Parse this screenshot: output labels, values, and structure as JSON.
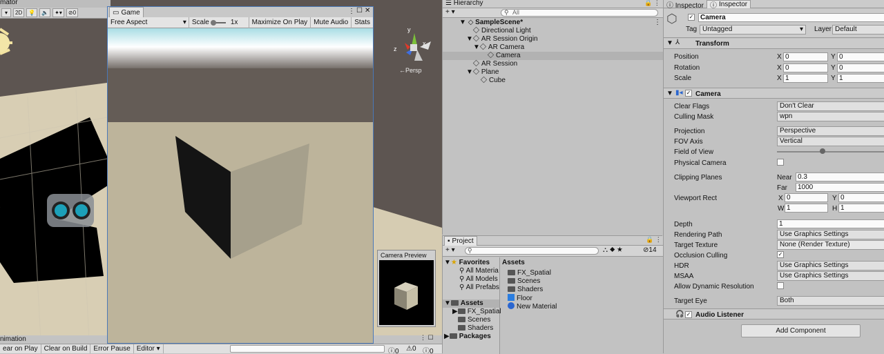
{
  "scene": {
    "title_fragment": "mator",
    "toolbar": {
      "mode_2d": "2D",
      "hidden_count": "0"
    },
    "persp_label": "←Persp",
    "gizmo": {
      "y": "y",
      "x": "x",
      "z": "z"
    }
  },
  "game": {
    "tab_label": "Game",
    "aspect": "Free Aspect",
    "scale_label": "Scale",
    "scale_value": "1x",
    "maximize": "Maximize On Play",
    "mute": "Mute Audio",
    "stats": "Stats"
  },
  "camera_preview": {
    "title": "Camera Preview"
  },
  "console": {
    "tab_label": "nimation",
    "clear_on_play": "ear on Play",
    "clear_on_build": "Clear on Build",
    "error_pause": "Error Pause",
    "editor": "Editor",
    "counts": [
      "0",
      "0",
      "0"
    ]
  },
  "hierarchy": {
    "tab_label": "Hierarchy",
    "search_placeholder": "All",
    "scene_name": "SampleScene*",
    "items": [
      {
        "label": "Directional Light"
      },
      {
        "label": "AR Session Origin"
      },
      {
        "label": "AR Camera"
      },
      {
        "label": "Camera"
      },
      {
        "label": "AR Session"
      },
      {
        "label": "Plane"
      },
      {
        "label": "Cube"
      }
    ]
  },
  "project": {
    "tab_label": "Project",
    "count": "14",
    "favorites_label": "Favorites",
    "favorites": [
      "All Materia",
      "All Models",
      "All Prefabs"
    ],
    "assets_label": "Assets",
    "asset_folders": [
      "FX_Spatial",
      "Scenes",
      "Shaders"
    ],
    "packages_label": "Packages",
    "assets_header": "Assets",
    "asset_items": [
      "FX_Spatial",
      "Scenes",
      "Shaders",
      "Floor",
      "New Material"
    ]
  },
  "inspector": {
    "tab_inactive": "Inspector",
    "tab_active": "Inspector",
    "object_name": "Camera",
    "tag_label": "Tag",
    "tag_value": "Untagged",
    "layer_label": "Layer",
    "layer_value": "Default",
    "transform": {
      "title": "Transform",
      "position_label": "Position",
      "pos_x": "0",
      "pos_y": "0",
      "rotation_label": "Rotation",
      "rot_x": "0",
      "rot_y": "0",
      "scale_label": "Scale",
      "scale_x": "1",
      "scale_y": "1"
    },
    "camera": {
      "title": "Camera",
      "clear_flags_label": "Clear Flags",
      "clear_flags": "Don't Clear",
      "culling_mask_label": "Culling Mask",
      "culling_mask": "wpn",
      "projection_label": "Projection",
      "projection": "Perspective",
      "fov_axis_label": "FOV Axis",
      "fov_axis": "Vertical",
      "fov_label": "Field of View",
      "fov_slider_fraction": 0.42,
      "physical_label": "Physical Camera",
      "clipping_label": "Clipping Planes",
      "near_label": "Near",
      "near": "0.3",
      "far_label": "Far",
      "far": "1000",
      "viewport_label": "Viewport Rect",
      "vp_x": "0",
      "vp_y": "0",
      "vp_w": "1",
      "vp_h": "1",
      "depth_label": "Depth",
      "depth": "1",
      "rendering_path_label": "Rendering Path",
      "rendering_path": "Use Graphics Settings",
      "target_texture_label": "Target Texture",
      "target_texture": "None (Render Texture)",
      "occlusion_label": "Occlusion Culling",
      "hdr_label": "HDR",
      "hdr": "Use Graphics Settings",
      "msaa_label": "MSAA",
      "msaa": "Use Graphics Settings",
      "dynres_label": "Allow Dynamic Resolution",
      "target_eye_label": "Target Eye",
      "target_eye": "Both"
    },
    "audio_listener": "Audio Listener",
    "add_component": "Add Component"
  },
  "colors": {
    "accent": "#4a78b8",
    "panel": "#c2c2c2",
    "dark_view": "#000000"
  }
}
